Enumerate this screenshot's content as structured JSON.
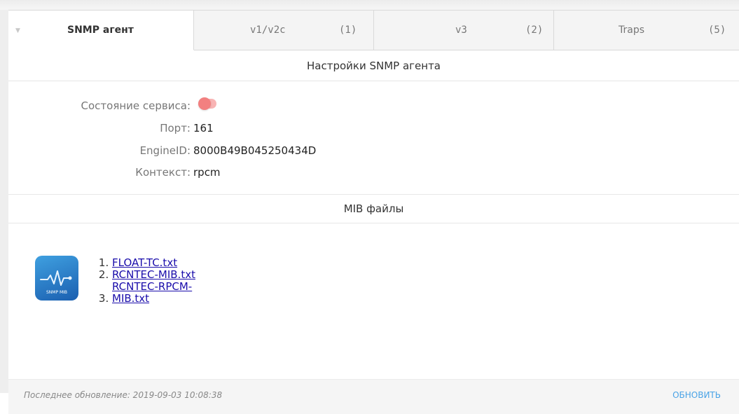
{
  "tabs": [
    {
      "label": "SNMP агент",
      "count": ""
    },
    {
      "label": "v1/v2c",
      "count": "(1)"
    },
    {
      "label": "v3",
      "count": "(2)"
    },
    {
      "label": "Traps",
      "count": "(5)"
    }
  ],
  "agent": {
    "title": "Настройки SNMP агента",
    "service_label": "Состояние сервиса:",
    "service_state": "off",
    "port_label": "Порт:",
    "port_value": "161",
    "engine_label": "EngineID:",
    "engine_value": "8000B49B045250434D",
    "context_label": "Контекст:",
    "context_value": "rpcm"
  },
  "mib": {
    "title": "MIB файлы",
    "icon_caption": "SNMP MIB",
    "files": [
      "FLOAT-TC.txt",
      "RCNTEC-MIB.txt",
      "RCNTEC-RPCM-MIB.txt"
    ]
  },
  "footer": {
    "updated": "Последнее обновление: 2019-09-03 10:08:38",
    "refresh": "ОБНОВИТЬ"
  },
  "colors": {
    "toggle_track": "#f8b4b4",
    "toggle_knob": "#f28080",
    "link": "#1a0dab",
    "refresh": "#4aa3e6"
  }
}
